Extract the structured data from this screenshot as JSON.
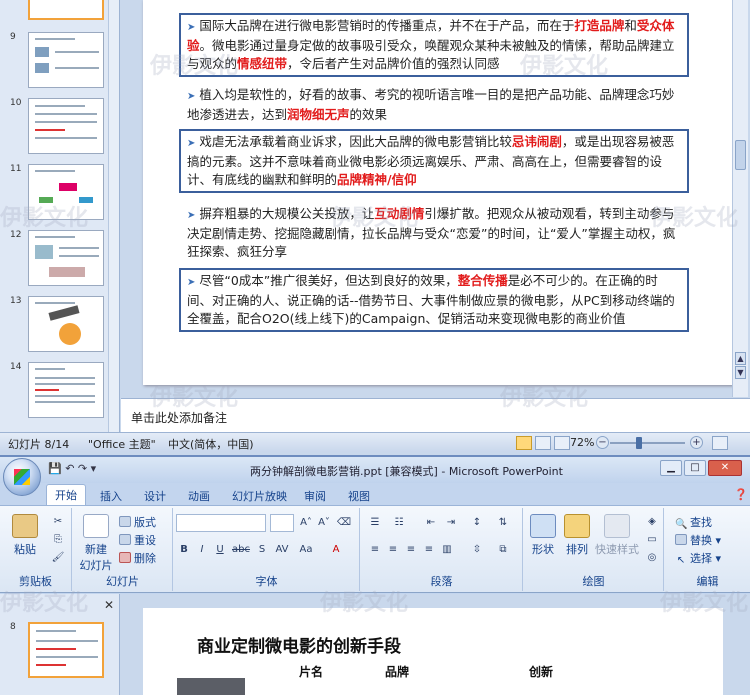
{
  "top_window": {
    "thumbnails": [
      {
        "num": "9"
      },
      {
        "num": "10"
      },
      {
        "num": "11"
      },
      {
        "num": "12"
      },
      {
        "num": "13"
      },
      {
        "num": "14"
      }
    ],
    "slide_bullets": [
      {
        "parts": [
          "国际大品牌在进行微电影营销时的传播重点，并不在于产品，而在于",
          "打造品牌",
          "和",
          "受众体验",
          "。微电影通过量身定做的故事吸引受众，唤醒观众某种未被触及的情愫，帮助品牌建立与观众的",
          "情感纽带",
          "，令后者产生对品牌价值的强烈认同感"
        ]
      },
      {
        "parts": [
          "植入均是软性的，好看的故事、考究的视听语言唯一目的是把产品功能、品牌理念巧妙地渗透进去，达到",
          "润物细无声",
          "的效果"
        ]
      },
      {
        "parts": [
          "戏虐无法承载着商业诉求，因此大品牌的微电影营销比较",
          "忌讳闹剧",
          "，或是出现容易被恶搞的元素。这并不意味着商业微电影必须远离娱乐、严肃、高高在上，但需要睿智的设计、有底线的幽默和鲜明的",
          "品牌精神/信仰",
          ""
        ]
      },
      {
        "parts": [
          "摒弃粗暴的大规模公关投放，让",
          "互动剧情",
          "引爆扩散。把观众从被动观看，转到主动参与决定剧情走势、挖掘隐藏剧情，拉长品牌与受众“恋爱”的时间，让“爱人”掌握主动权，疯狂探索、疯狂分享"
        ]
      },
      {
        "parts": [
          "尽管“0成本”推广很美好，但达到良好的效果，",
          "整合传播",
          "是必不可少的。在正确的时间、对正确的人、说正确的话--借势节日、大事件制做应景的微电影，从PC到移动终端的全覆盖，配合O2O(线上线下)的Campaign、促销活动来变现微电影的商业价值"
        ]
      }
    ],
    "notes_placeholder": "单击此处添加备注",
    "status": {
      "slide_counter": "幻灯片 8/14",
      "theme": "\"Office 主题\"",
      "language": "中文(简体，中国)",
      "zoom": "72%"
    }
  },
  "bottom_window": {
    "title": "两分钟解剖微电影营销.ppt [兼容模式] - Microsoft PowerPoint",
    "tabs": [
      "开始",
      "插入",
      "设计",
      "动画",
      "幻灯片放映",
      "审阅",
      "视图"
    ],
    "clipboard": {
      "paste": "粘贴",
      "group": "剪贴板"
    },
    "slides_group": {
      "new_slide_1": "新建",
      "new_slide_2": "幻灯片",
      "layout": "版式",
      "reset": "重设",
      "delete": "删除",
      "group": "幻灯片"
    },
    "font_group": "字体",
    "paragraph_group": "段落",
    "drawing": {
      "shape": "形状",
      "arrange": "排列",
      "quick_styles": "快速样式",
      "group": "绘图"
    },
    "editing": {
      "find": "查找",
      "replace": "替换",
      "select": "选择",
      "group": "编辑"
    },
    "slide": {
      "thumb_num": "8",
      "title": "商业定制微电影的创新手段",
      "col_film": "片名",
      "col_brand": "品牌",
      "col_innovation": "创新"
    }
  },
  "watermark": "伊影文化"
}
